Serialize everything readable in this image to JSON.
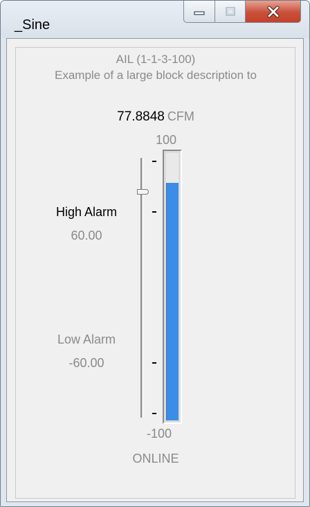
{
  "window": {
    "title": "_Sine",
    "buttons": {
      "minimize": "minimize",
      "maximize": "maximize",
      "close": "close"
    }
  },
  "block": {
    "tag": "AIL (1-1-3-100)",
    "description": "Example of a large block description to",
    "value": "77.8848",
    "unit": "CFM",
    "range_max": "100",
    "range_min": "-100",
    "value_fraction": 0.889,
    "status": "ONLINE"
  },
  "alarms": {
    "high_label": "High Alarm",
    "high_value": "60.00",
    "high_fraction": 0.8,
    "low_label": "Low Alarm",
    "low_value": "-60.00",
    "low_fraction": 0.2
  },
  "colors": {
    "bar_fill": "#3b8de6",
    "inactive_text": "#8a8a8a",
    "close_button": "#c5402a"
  },
  "icons": [
    "minimize-icon",
    "maximize-icon",
    "close-icon"
  ]
}
